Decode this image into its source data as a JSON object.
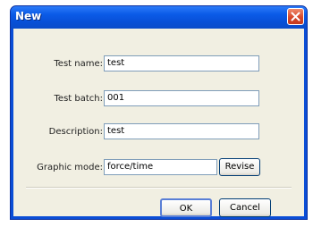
{
  "window": {
    "title": "New"
  },
  "form": {
    "test_name": {
      "label": "Test name:",
      "value": "test"
    },
    "test_batch": {
      "label": "Test batch:",
      "value": "001"
    },
    "description": {
      "label": "Description:",
      "value": "test"
    },
    "graphic_mode": {
      "label": "Graphic mode:",
      "value": "force/time",
      "revise_label": "Revise"
    }
  },
  "buttons": {
    "ok": "OK",
    "cancel": "Cancel"
  }
}
